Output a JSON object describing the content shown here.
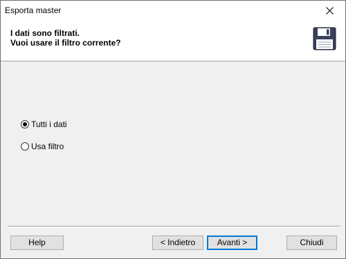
{
  "window": {
    "title": "Esporta master"
  },
  "header": {
    "title": "I dati sono filtrati.",
    "subtitle": "Vuoi usare il filtro corrente?",
    "icon": "floppy-disk-icon"
  },
  "options": {
    "all_data_label": "Tutti i dati",
    "use_filter_label": "Usa filtro",
    "selected": "Tutti i dati"
  },
  "buttons": {
    "help": "Help",
    "back": "< Indietro",
    "next": "Avanti >",
    "close": "Chiudi"
  }
}
